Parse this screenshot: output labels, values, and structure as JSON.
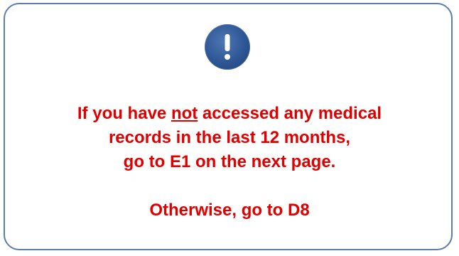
{
  "icon": "exclamation-icon",
  "colors": {
    "message": "#e00000",
    "border": "#5b7eae",
    "icon": "#2d5694"
  },
  "message": {
    "line1_pre": "If you have ",
    "line1_emph": "not",
    "line1_post": " accessed any medical",
    "line2": "records in the last 12 months,",
    "line3": "go to E1 on the next page.",
    "line4": "Otherwise, go to D8"
  }
}
